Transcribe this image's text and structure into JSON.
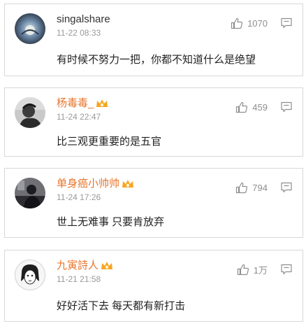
{
  "comments": [
    {
      "username": "singalshare",
      "vip": false,
      "timestamp": "11-22 08:33",
      "likes": "1070",
      "text": "有时候不努力一把，你都不知道什么是绝望"
    },
    {
      "username": "杨毒毒_",
      "vip": true,
      "timestamp": "11-24 22:47",
      "likes": "459",
      "text": "比三观更重要的是五官"
    },
    {
      "username": "单身癌小帅帅",
      "vip": true,
      "timestamp": "11-24 17:26",
      "likes": "794",
      "text": "世上无难事 只要肯放弃"
    },
    {
      "username": "九寅詩人",
      "vip": true,
      "timestamp": "11-21 21:58",
      "likes": "1万",
      "text": "好好活下去 每天都有新打击"
    }
  ],
  "icons": {
    "like": "thumbs-up-icon",
    "reply": "comment-reply-icon",
    "badge": "vip-crown-badge-icon"
  },
  "colors": {
    "vip_username": "#e8742a",
    "normal_username": "#333333",
    "meta": "#9a9a9a",
    "border": "#d8d8d8"
  }
}
